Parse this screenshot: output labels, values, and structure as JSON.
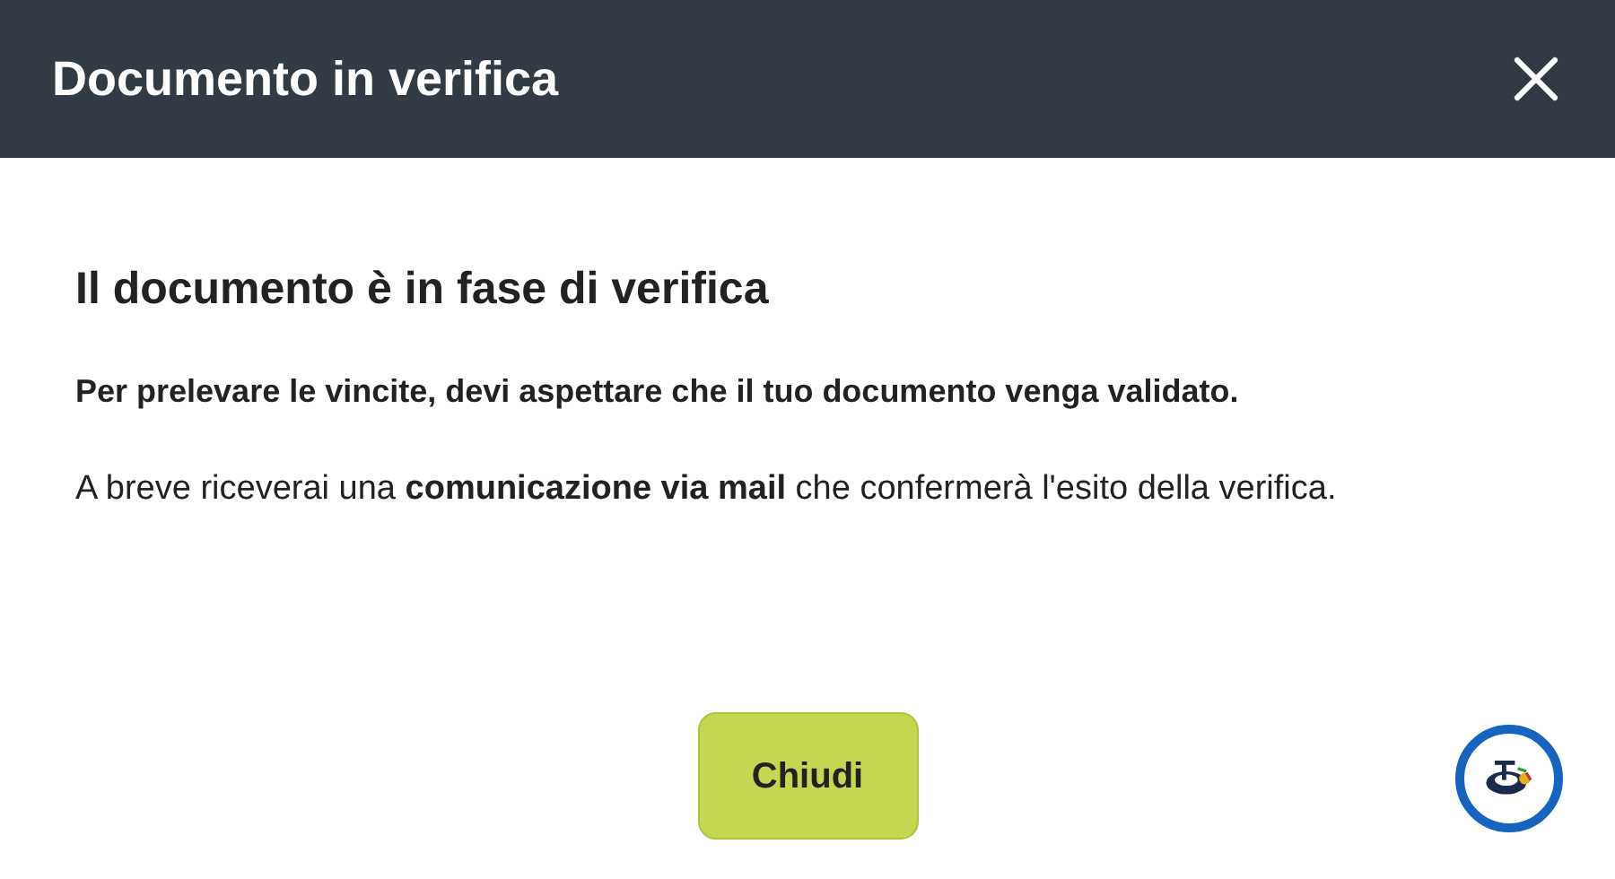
{
  "header": {
    "title": "Documento in verifica"
  },
  "body": {
    "heading": "Il documento è in fase di verifica",
    "notice": "Per prelevare le vincite, devi aspettare che il tuo documento venga validato.",
    "message": "A breve riceverai una **comunicazione via mail** che confermerà l'esito della verifica."
  },
  "buttons": [
    "Chiudi"
  ]
}
